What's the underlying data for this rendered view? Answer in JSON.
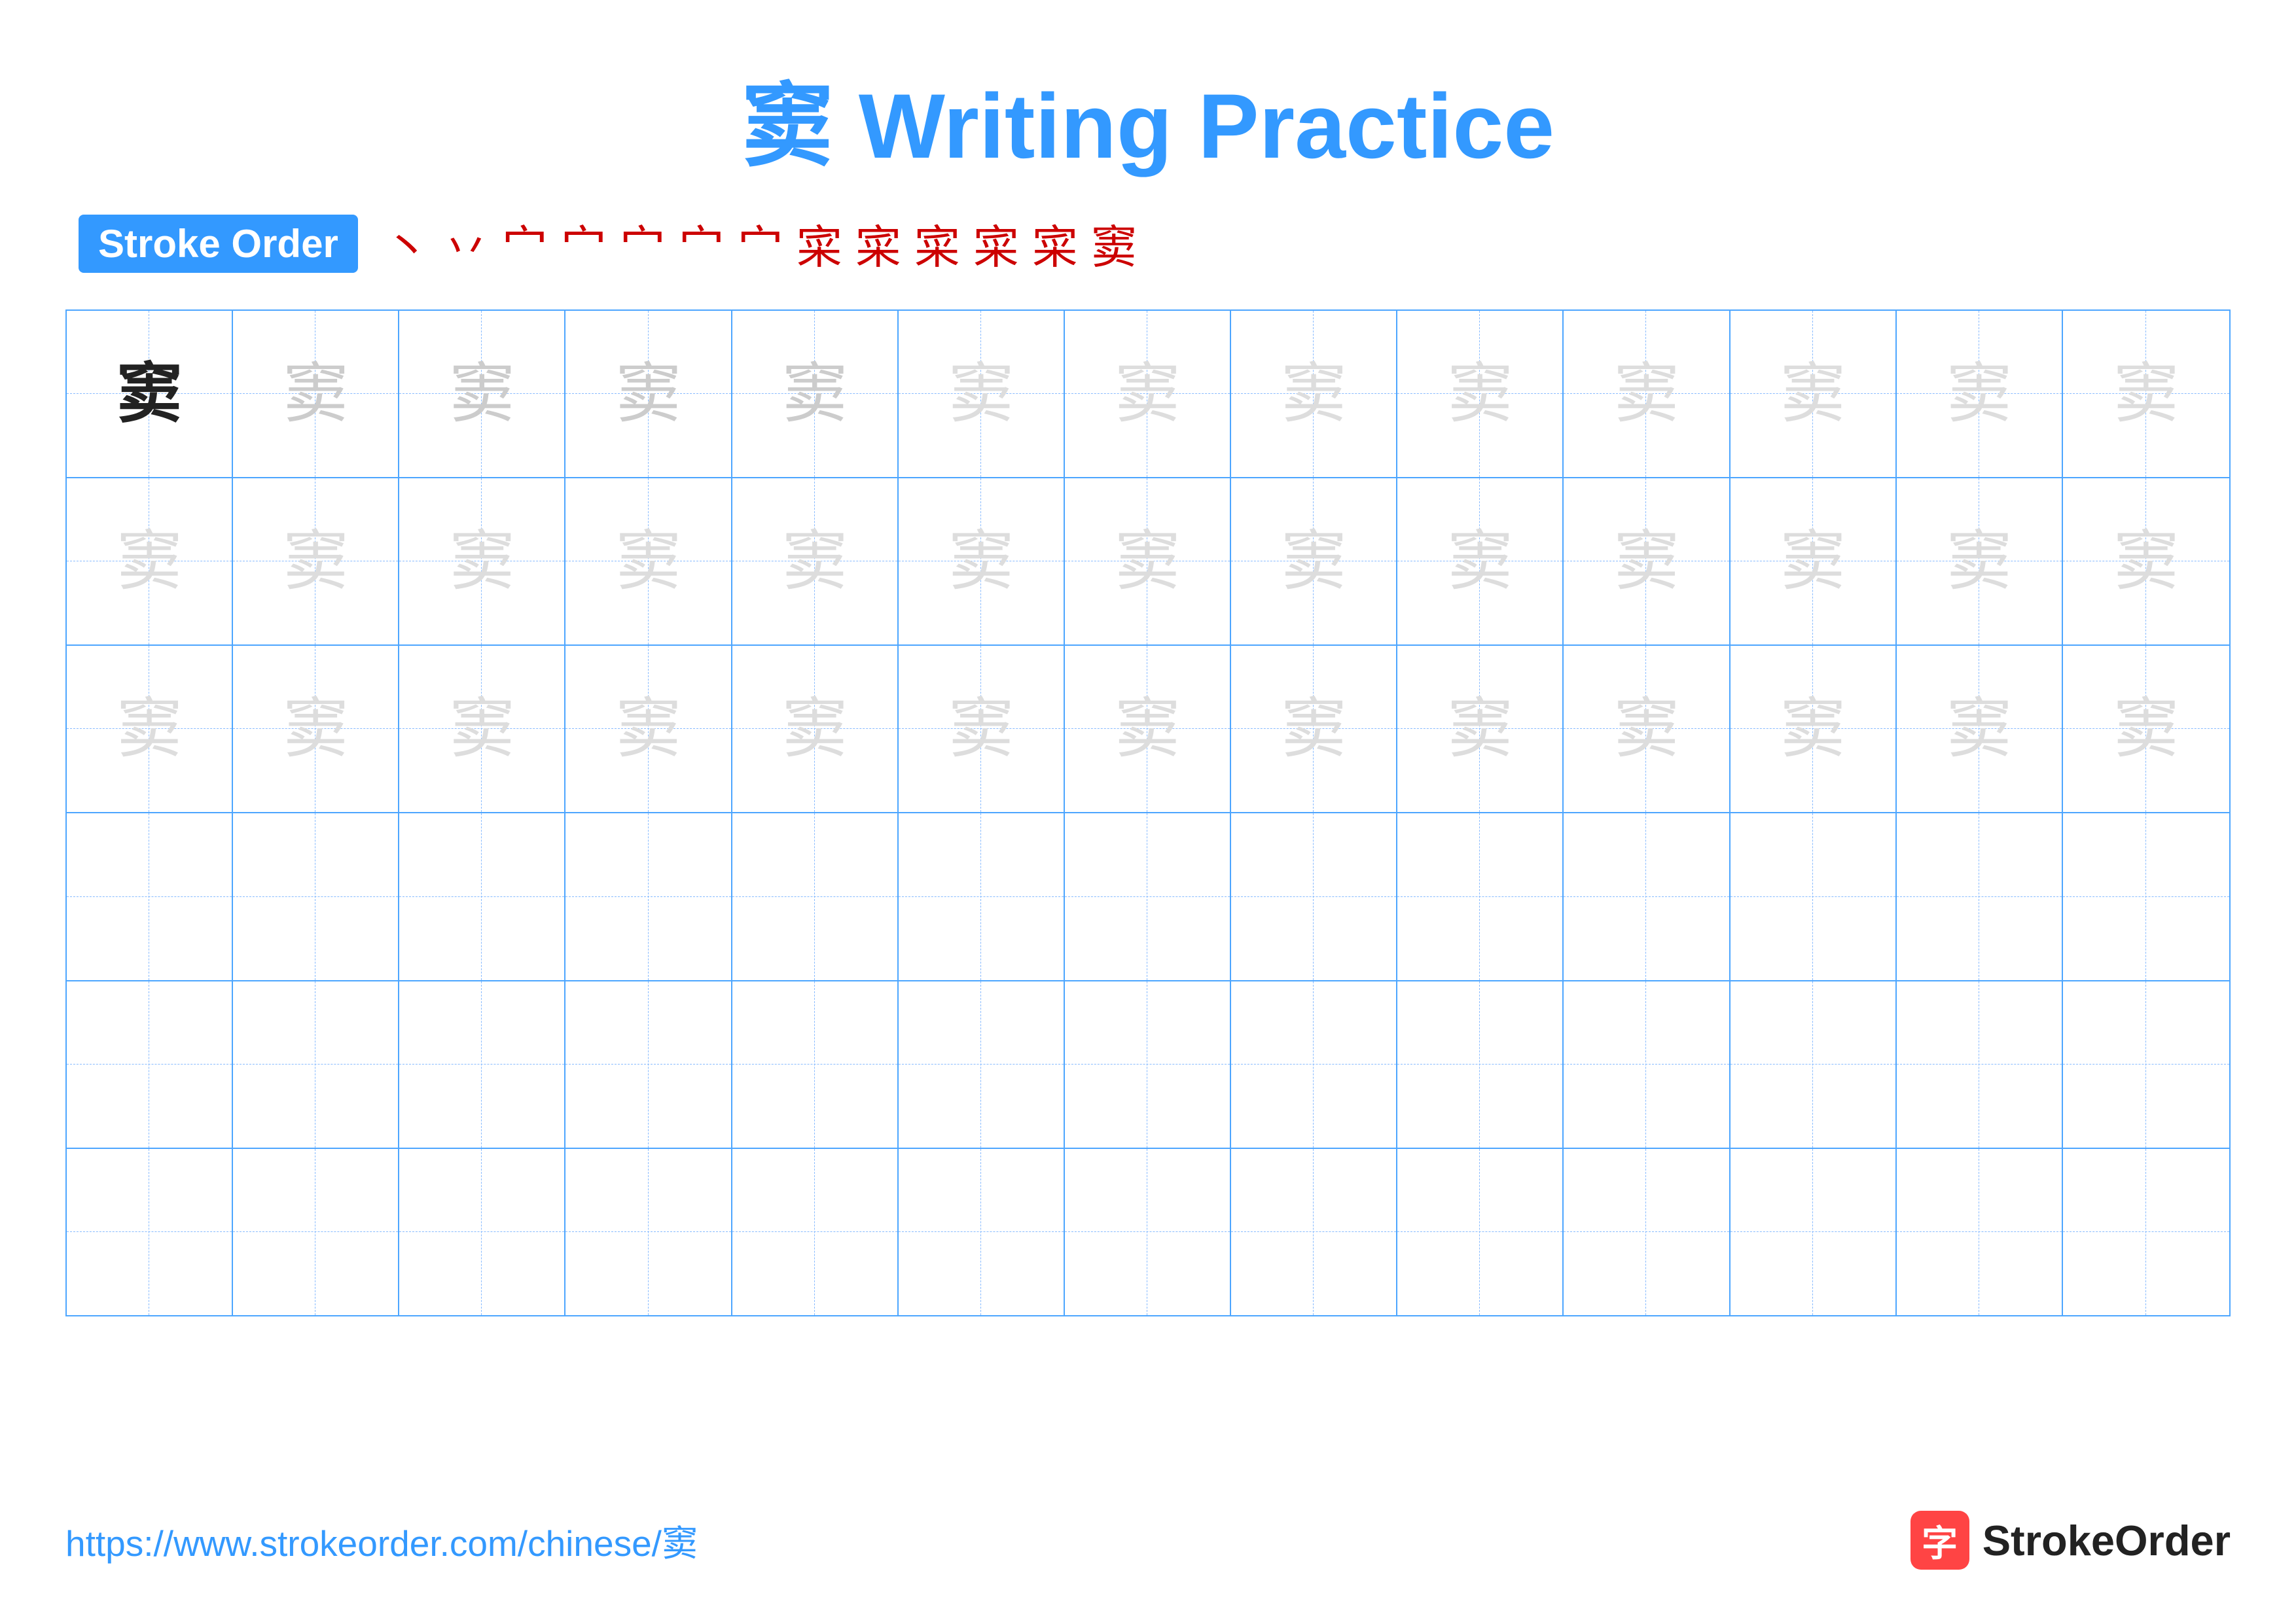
{
  "title": {
    "char": "窦",
    "text": " Writing Practice"
  },
  "stroke_order": {
    "badge_label": "Stroke Order",
    "strokes": [
      "丶",
      "丷",
      "宀",
      "宀",
      "宀",
      "宀",
      "宀",
      "寀",
      "寀",
      "寀",
      "寀",
      "寀",
      "窦"
    ]
  },
  "grid": {
    "rows": [
      {
        "cells": [
          {
            "char": "窦",
            "style": "dark"
          },
          {
            "char": "窦",
            "style": "medium"
          },
          {
            "char": "窦",
            "style": "medium"
          },
          {
            "char": "窦",
            "style": "medium"
          },
          {
            "char": "窦",
            "style": "medium"
          },
          {
            "char": "窦",
            "style": "light"
          },
          {
            "char": "窦",
            "style": "light"
          },
          {
            "char": "窦",
            "style": "light"
          },
          {
            "char": "窦",
            "style": "light"
          },
          {
            "char": "窦",
            "style": "light"
          },
          {
            "char": "窦",
            "style": "light"
          },
          {
            "char": "窦",
            "style": "light"
          },
          {
            "char": "窦",
            "style": "light"
          }
        ]
      },
      {
        "cells": [
          {
            "char": "窦",
            "style": "light"
          },
          {
            "char": "窦",
            "style": "light"
          },
          {
            "char": "窦",
            "style": "light"
          },
          {
            "char": "窦",
            "style": "light"
          },
          {
            "char": "窦",
            "style": "light"
          },
          {
            "char": "窦",
            "style": "light"
          },
          {
            "char": "窦",
            "style": "light"
          },
          {
            "char": "窦",
            "style": "light"
          },
          {
            "char": "窦",
            "style": "light"
          },
          {
            "char": "窦",
            "style": "light"
          },
          {
            "char": "窦",
            "style": "light"
          },
          {
            "char": "窦",
            "style": "light"
          },
          {
            "char": "窦",
            "style": "light"
          }
        ]
      },
      {
        "cells": [
          {
            "char": "窦",
            "style": "light"
          },
          {
            "char": "窦",
            "style": "light"
          },
          {
            "char": "窦",
            "style": "light"
          },
          {
            "char": "窦",
            "style": "light"
          },
          {
            "char": "窦",
            "style": "light"
          },
          {
            "char": "窦",
            "style": "light"
          },
          {
            "char": "窦",
            "style": "light"
          },
          {
            "char": "窦",
            "style": "light"
          },
          {
            "char": "窦",
            "style": "light"
          },
          {
            "char": "窦",
            "style": "light"
          },
          {
            "char": "窦",
            "style": "light"
          },
          {
            "char": "窦",
            "style": "light"
          },
          {
            "char": "窦",
            "style": "light"
          }
        ]
      },
      {
        "cells": [
          {
            "char": "",
            "style": "empty"
          },
          {
            "char": "",
            "style": "empty"
          },
          {
            "char": "",
            "style": "empty"
          },
          {
            "char": "",
            "style": "empty"
          },
          {
            "char": "",
            "style": "empty"
          },
          {
            "char": "",
            "style": "empty"
          },
          {
            "char": "",
            "style": "empty"
          },
          {
            "char": "",
            "style": "empty"
          },
          {
            "char": "",
            "style": "empty"
          },
          {
            "char": "",
            "style": "empty"
          },
          {
            "char": "",
            "style": "empty"
          },
          {
            "char": "",
            "style": "empty"
          },
          {
            "char": "",
            "style": "empty"
          }
        ]
      },
      {
        "cells": [
          {
            "char": "",
            "style": "empty"
          },
          {
            "char": "",
            "style": "empty"
          },
          {
            "char": "",
            "style": "empty"
          },
          {
            "char": "",
            "style": "empty"
          },
          {
            "char": "",
            "style": "empty"
          },
          {
            "char": "",
            "style": "empty"
          },
          {
            "char": "",
            "style": "empty"
          },
          {
            "char": "",
            "style": "empty"
          },
          {
            "char": "",
            "style": "empty"
          },
          {
            "char": "",
            "style": "empty"
          },
          {
            "char": "",
            "style": "empty"
          },
          {
            "char": "",
            "style": "empty"
          },
          {
            "char": "",
            "style": "empty"
          }
        ]
      },
      {
        "cells": [
          {
            "char": "",
            "style": "empty"
          },
          {
            "char": "",
            "style": "empty"
          },
          {
            "char": "",
            "style": "empty"
          },
          {
            "char": "",
            "style": "empty"
          },
          {
            "char": "",
            "style": "empty"
          },
          {
            "char": "",
            "style": "empty"
          },
          {
            "char": "",
            "style": "empty"
          },
          {
            "char": "",
            "style": "empty"
          },
          {
            "char": "",
            "style": "empty"
          },
          {
            "char": "",
            "style": "empty"
          },
          {
            "char": "",
            "style": "empty"
          },
          {
            "char": "",
            "style": "empty"
          },
          {
            "char": "",
            "style": "empty"
          }
        ]
      }
    ]
  },
  "footer": {
    "url": "https://www.strokeorder.com/chinese/窦",
    "logo_text": "StrokeOrder",
    "logo_char": "字"
  }
}
